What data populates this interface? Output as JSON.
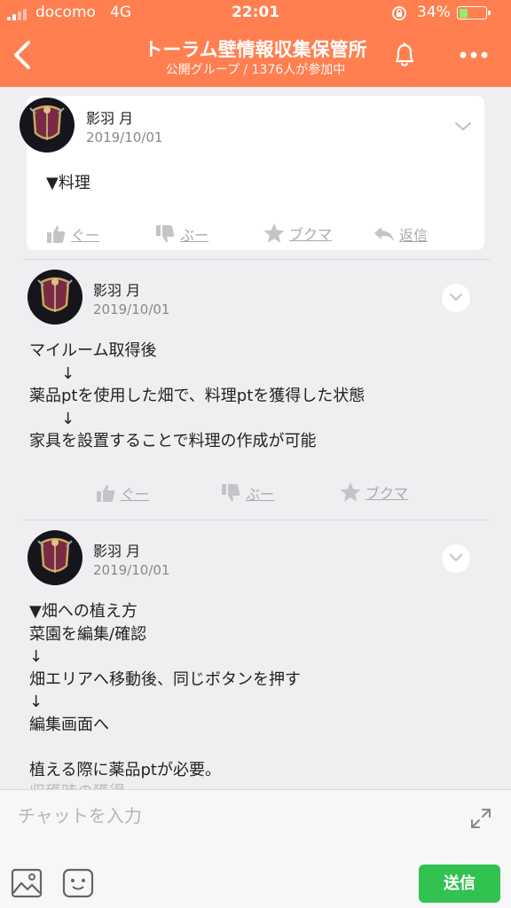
{
  "status_bar": {
    "carrier": "docomo",
    "network": "4G",
    "time": "22:01",
    "battery_percent": "34%",
    "battery_level": 0.34
  },
  "header": {
    "title": "トーラム壁情報収集保管所",
    "subtitle": "公開グループ / 1376人が参加中"
  },
  "posts": [
    {
      "author": "影羽 月",
      "date": "2019/10/01",
      "body": "▼料理",
      "actions": {
        "like": "ぐー",
        "dislike": "ぶー",
        "bookmark": "ブクマ",
        "reply": "返信"
      }
    },
    {
      "author": "影羽 月",
      "date": "2019/10/01",
      "body": "マイルーム取得後\n　　↓\n薬品ptを使用した畑で、料理ptを獲得した状態\n　　↓\n家具を設置することで料理の作成が可能",
      "actions": {
        "like": "ぐー",
        "dislike": "ぶー",
        "bookmark": "ブクマ"
      }
    },
    {
      "author": "影羽 月",
      "date": "2019/10/01",
      "body": "▼畑への植え方\n菜園を編集/確認\n↓\n畑エリアへ移動後、同じボタンを押す\n↓\n編集画面へ\n\n植える際に薬品ptが必要。",
      "body_cut_off": "収穫時の獲得..."
    }
  ],
  "input": {
    "placeholder": "チャットを入力",
    "send_label": "送信"
  }
}
